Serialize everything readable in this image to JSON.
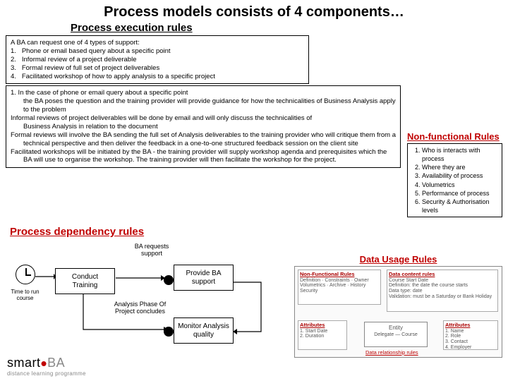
{
  "title": "Process models consists of 4 components…",
  "exec": {
    "heading": "Process execution rules",
    "intro": "A BA can request one of 4 types of support:",
    "items": [
      "Phone or email based query about a specific point",
      "Informal review of a project deliverable",
      "Formal review of full set of project deliverables",
      "Facilitated workshop of how to apply analysis to a specific project"
    ],
    "detail": {
      "p1a": "1. In the case of phone or email query about a specific point",
      "p1b": "the BA poses the question and the training provider will provide guidance for how the technicalities of Business Analysis apply to the problem",
      "p2a": "Informal reviews of project deliverables will be done by email and will only discuss the technicalities of",
      "p2b": "Business Analysis in relation to the document",
      "p3": "Formal reviews will involve the BA sending the full set of Analysis deliverables to the training provider who will critique them from a technical perspective and then deliver the feedback in a one-to-one structured feedback session on the client site",
      "p4": "Facilitated workshops will be initiated by the BA  - the training provider will supply workshop agenda and prerequisites which the BA will use to organise the workshop. The training provider will then facilitate the workshop for the project."
    }
  },
  "nf": {
    "heading": "Non-functional Rules",
    "items": [
      "Who is interacts with process",
      "Where they are",
      "Availability of process",
      "Volumetrics",
      "Performance of process",
      "Security & Authorisation levels"
    ]
  },
  "dep": {
    "heading": "Process dependency rules",
    "time_label": "Time to run course",
    "conduct": "Conduct Training",
    "provide": "Provide BA support",
    "monitor": "Monitor Analysis quality",
    "req": "BA requests support",
    "phase": "Analysis Phase Of Project concludes"
  },
  "du": {
    "heading": "Data Usage Rules",
    "nf_title": "Non-Functional Rules",
    "content_title": "Data content rules",
    "attr": "Attributes",
    "entity": "Entity",
    "rel": "Data relationship rules"
  },
  "logo": {
    "brand1": "smart",
    "brand2": "BA",
    "tag": "distance learning programme"
  }
}
